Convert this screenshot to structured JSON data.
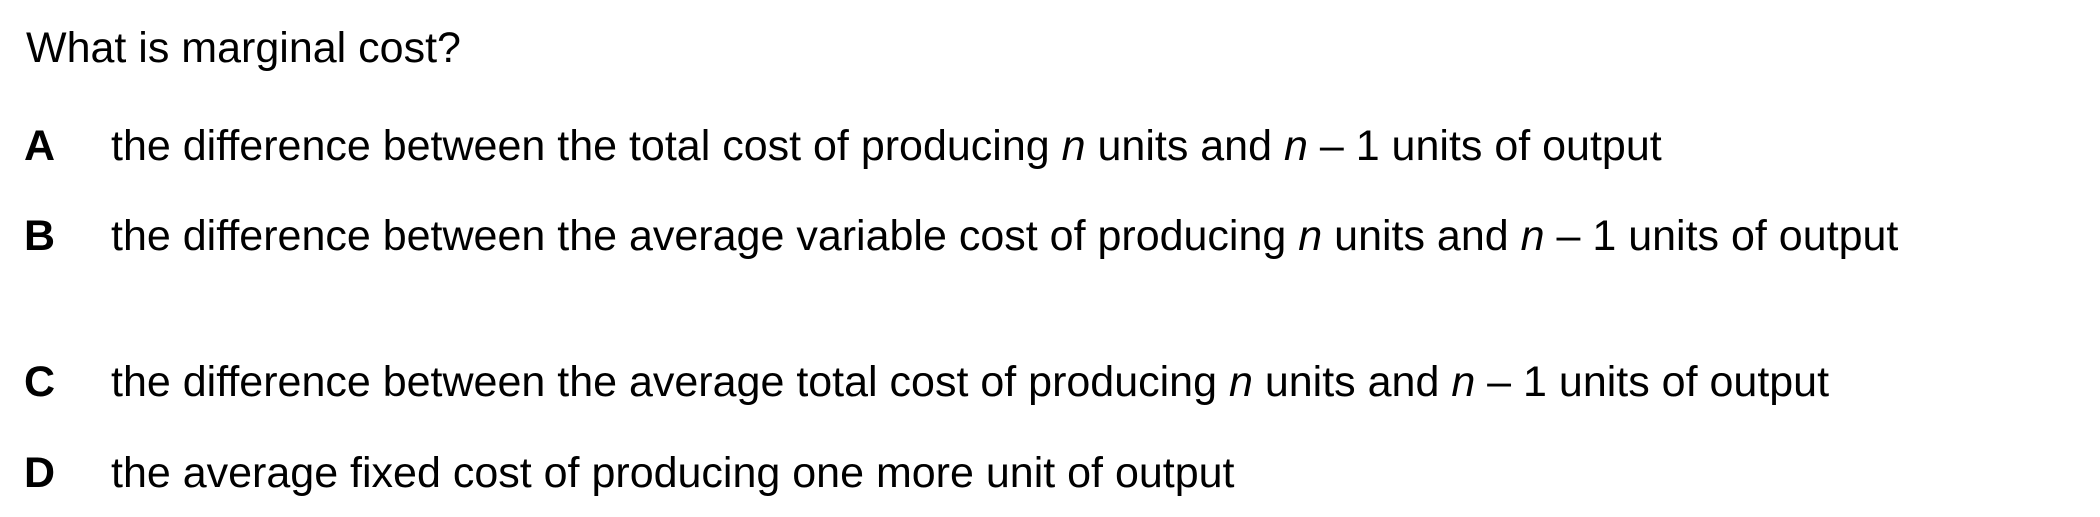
{
  "question": "What is marginal cost?",
  "options": [
    {
      "letter": "A",
      "before": "the difference between the total cost of producing ",
      "var1": "n",
      "middle": " units and ",
      "var2": "n",
      "after": " – 1 units of output"
    },
    {
      "letter": "B",
      "before": "the difference between the average variable cost of producing ",
      "var1": "n",
      "middle": " units and ",
      "var2": "n",
      "after": " – 1 units of output"
    },
    {
      "letter": "C",
      "before": "the difference between the average total cost of producing ",
      "var1": "n",
      "middle": " units and ",
      "var2": "n",
      "after": " – 1 units of output"
    },
    {
      "letter": "D",
      "text": "the average fixed cost of producing one more unit of output"
    }
  ]
}
